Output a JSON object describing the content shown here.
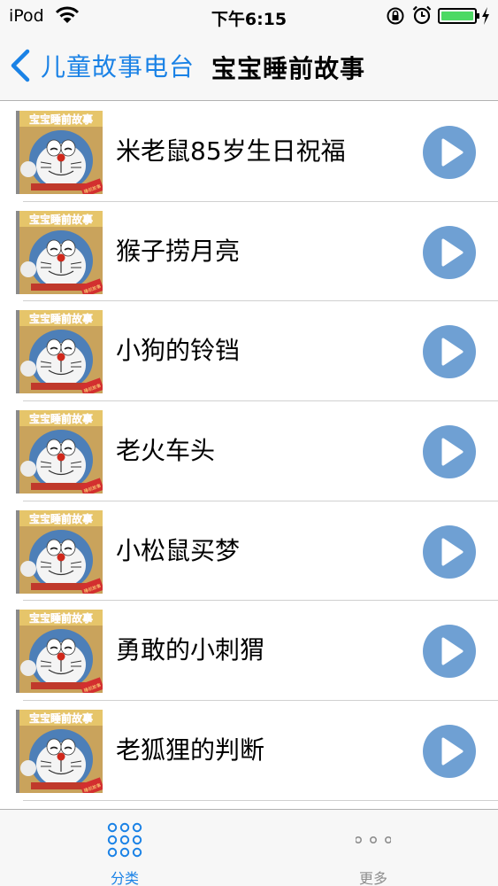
{
  "status_bar": {
    "carrier": "iPod",
    "time": "下午6:15",
    "icons": [
      "wifi-icon",
      "rotation-lock-icon",
      "alarm-icon",
      "battery-icon",
      "charging-icon"
    ]
  },
  "nav": {
    "back_label": "儿童故事电台",
    "title": "宝宝睡前故事"
  },
  "thumbnail": {
    "banner_text": "宝宝睡前故事",
    "stamp_text": "睡前故事"
  },
  "stories": [
    {
      "title": "米老鼠85岁生日祝福"
    },
    {
      "title": "猴子捞月亮"
    },
    {
      "title": "小狗的铃铛"
    },
    {
      "title": "老火车头"
    },
    {
      "title": "小松鼠买梦"
    },
    {
      "title": "勇敢的小刺猬"
    },
    {
      "title": "老狐狸的判断"
    }
  ],
  "tab_bar": {
    "tabs": [
      {
        "label": "分类",
        "icon": "grid-icon",
        "selected": true
      },
      {
        "label": "更多",
        "icon": "more-icon",
        "selected": false
      }
    ]
  },
  "colors": {
    "accent": "#1a82e6",
    "play_button": "#6fa0d3",
    "bar_background": "#f7f7f7",
    "battery": "#4cd964"
  }
}
